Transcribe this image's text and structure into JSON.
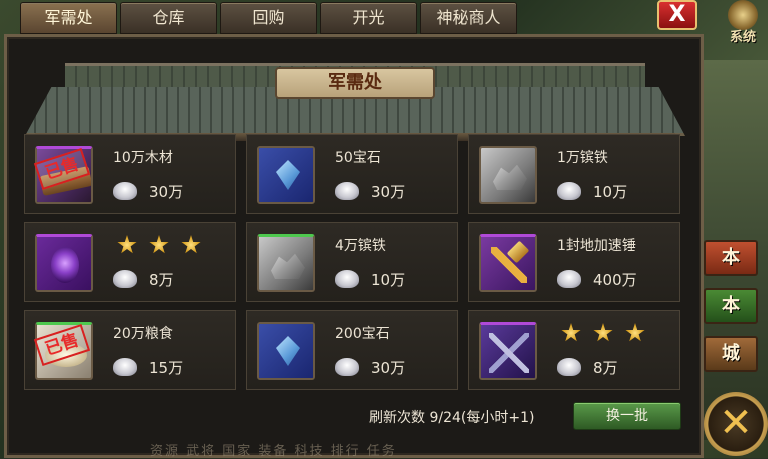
{
  "tabs": [
    {
      "label": "军需处",
      "active": true
    },
    {
      "label": "仓库",
      "active": false
    },
    {
      "label": "回购",
      "active": false
    },
    {
      "label": "开光",
      "active": false
    },
    {
      "label": "神秘商人",
      "active": false
    }
  ],
  "close_label": "X",
  "system_label": "系统",
  "panel_title": "军需处",
  "sold_label": "已售",
  "items": [
    {
      "name": "10万木材",
      "price": "30万",
      "sold": true,
      "icon": "lumber-icon"
    },
    {
      "name": "50宝石",
      "price": "30万",
      "sold": false,
      "icon": "gem-icon"
    },
    {
      "name": "1万镔铁",
      "price": "10万",
      "sold": false,
      "icon": "iron-ore-icon"
    },
    {
      "name": "",
      "price": "8万",
      "sold": false,
      "stars": 3,
      "icon": "scroll-icon"
    },
    {
      "name": "4万镔铁",
      "price": "10万",
      "sold": false,
      "icon": "iron-ore-icon"
    },
    {
      "name": "1封地加速锤",
      "price": "400万",
      "sold": false,
      "icon": "hammer-icon"
    },
    {
      "name": "20万粮食",
      "price": "15万",
      "sold": true,
      "icon": "food-icon"
    },
    {
      "name": "200宝石",
      "price": "30万",
      "sold": false,
      "icon": "gem-icon"
    },
    {
      "name": "",
      "price": "8万",
      "sold": false,
      "stars": 3,
      "icon": "weapon-icon"
    }
  ],
  "refresh_text": "刷新次数 9/24(每小时+1)",
  "refresh_button": "换一批",
  "side_buttons": [
    "本",
    "本",
    "城"
  ],
  "bottom_bar": "资源 武将 国家 装备 科技 排行 任务",
  "colors": {
    "accent": "#e8c070",
    "sold": "#e82a2a",
    "refresh_button": "#4a8a34"
  }
}
